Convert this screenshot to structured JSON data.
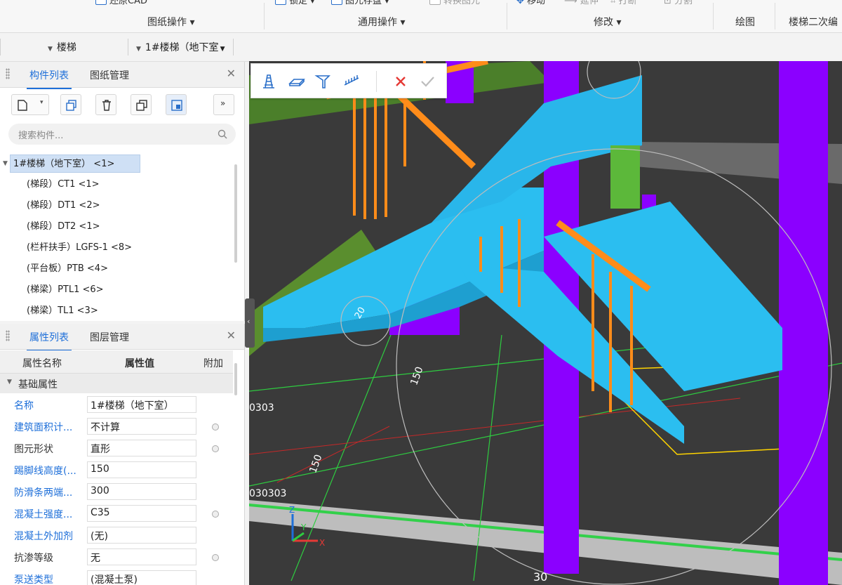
{
  "ribbon": {
    "top_items": [
      "还原CAD",
      "锁定",
      "图元存盘",
      "转换图元",
      "移动",
      "延伸",
      "打断",
      "分割"
    ],
    "groups": [
      "图纸操作",
      "通用操作",
      "修改",
      "绘图",
      "楼梯二次编"
    ]
  },
  "selectors": {
    "floor": "楼梯",
    "component": "1#楼梯（地下室"
  },
  "component_panel": {
    "tabs": [
      "构件列表",
      "图纸管理"
    ],
    "search_placeholder": "搜索构件...",
    "tree_root": "1#楼梯（地下室） <1>",
    "tree_items": [
      "(梯段）CT1 <1>",
      "(梯段）DT1 <2>",
      "(梯段）DT2 <1>",
      "(栏杆扶手）LGFS-1 <8>",
      "(平台板）PTB <4>",
      "(梯梁）PTL1 <6>",
      "(梯梁）TL1 <3>"
    ]
  },
  "property_panel": {
    "tabs": [
      "属性列表",
      "图层管理"
    ],
    "headers": [
      "属性名称",
      "属性值",
      "附加"
    ],
    "group": "基础属性",
    "rows": [
      {
        "name": "名称",
        "value": "1#楼梯（地下室）"
      },
      {
        "name": "建筑面积计...",
        "value": "不计算"
      },
      {
        "name": "图元形状",
        "value": "直形"
      },
      {
        "name": "踢脚线高度(...",
        "value": "150"
      },
      {
        "name": "防滑条两端...",
        "value": "300"
      },
      {
        "name": "混凝土强度...",
        "value": "C35"
      },
      {
        "name": "混凝土外加剂",
        "value": "(无)"
      },
      {
        "name": "抗渗等级",
        "value": "无"
      },
      {
        "name": "泵送类型",
        "value": "(混凝土泵)"
      }
    ]
  },
  "viewport": {
    "labels": [
      "150",
      "150",
      "20",
      "0303",
      "030303",
      "30"
    ],
    "axis": {
      "z": "Z",
      "y": "Y",
      "x": "X"
    }
  }
}
